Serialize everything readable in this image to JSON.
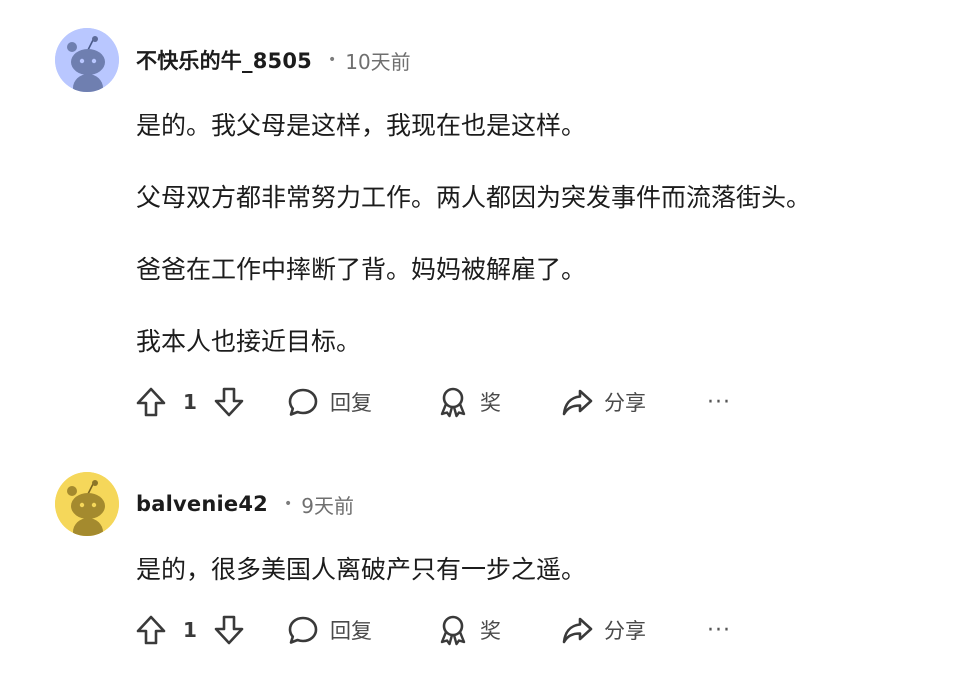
{
  "comments": [
    {
      "username": "不快乐的牛_8505",
      "separator": "•",
      "time": "10天前",
      "avatar_color": "#b9c7ff",
      "paragraphs": [
        "是的。我父母是这样，我现在也是这样。",
        "父母双方都非常努力工作。两人都因为突发事件而流落街头。",
        "爸爸在工作中摔断了背。妈妈被解雇了。",
        "我本人也接近目标。"
      ],
      "votes": "1",
      "reply_label": "回复",
      "award_label": "奖",
      "share_label": "分享",
      "more_label": "···"
    },
    {
      "username": "balvenie42",
      "separator": "•",
      "time": "9天前",
      "avatar_color": "#f5d75a",
      "paragraphs": [
        "是的，很多美国人离破产只有一步之遥。"
      ],
      "votes": "1",
      "reply_label": "回复",
      "award_label": "奖",
      "share_label": "分享",
      "more_label": "···"
    }
  ],
  "icons": {
    "upvote": "upvote-arrow-icon",
    "downvote": "downvote-arrow-icon",
    "reply": "speech-bubble-icon",
    "award": "award-ribbon-icon",
    "share": "share-arrow-icon",
    "more": "more-dots-icon"
  }
}
